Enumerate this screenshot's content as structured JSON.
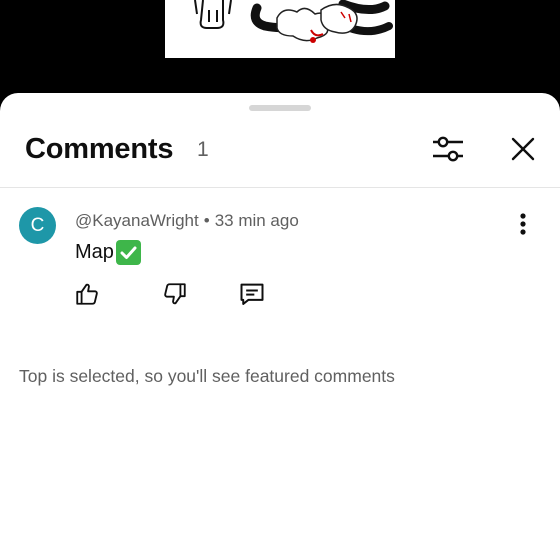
{
  "header": {
    "title": "Comments",
    "count": "1"
  },
  "icons": {
    "filter": "sliders-icon",
    "close": "close-icon",
    "more": "more-vert-icon",
    "like": "thumb-up-icon",
    "dislike": "thumb-down-icon",
    "reply": "comment-icon",
    "check": "check-mark-emoji"
  },
  "comment": {
    "avatar_letter": "C",
    "avatar_color": "#1e97a8",
    "author": "@KayanaWright",
    "separator": "•",
    "time": "33 min ago",
    "text": "Map"
  },
  "footer_note": "Top is selected, so you'll see featured comments"
}
